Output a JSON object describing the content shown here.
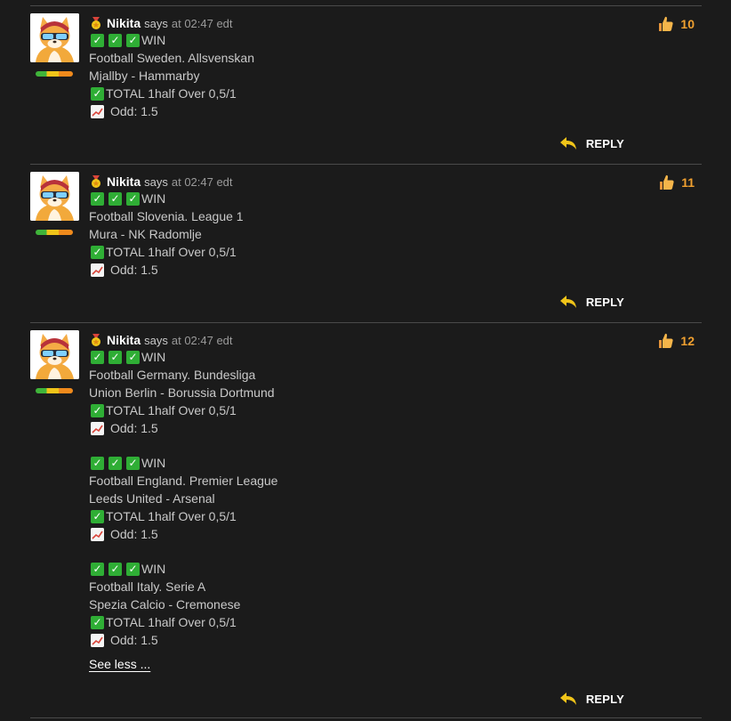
{
  "comments": [
    {
      "author": "Nikita",
      "says": "says",
      "time": "at 02:47 edt",
      "likes": "10",
      "reply_label": "REPLY",
      "blocks": [
        {
          "status": "WIN",
          "league": "Football Sweden. Allsvenskan",
          "match": "Mjallby - Hammarby",
          "bet": "TOTAL 1half Over  0,5/1",
          "odd": "Odd: 1.5"
        }
      ]
    },
    {
      "author": "Nikita",
      "says": "says",
      "time": "at 02:47 edt",
      "likes": "11",
      "reply_label": "REPLY",
      "blocks": [
        {
          "status": "WIN",
          "league": "Football Slovenia. League 1",
          "match": "Mura - NK Radomlje",
          "bet": "TOTAL 1half Over  0,5/1",
          "odd": "Odd: 1.5"
        }
      ]
    },
    {
      "author": "Nikita",
      "says": "says",
      "time": "at 02:47 edt",
      "likes": "12",
      "reply_label": "REPLY",
      "see_less": "See less ...",
      "blocks": [
        {
          "status": "WIN",
          "league": "Football Germany. Bundesliga",
          "match": "Union Berlin - Borussia Dortmund",
          "bet": "TOTAL 1half Over  0,5/1",
          "odd": "Odd: 1.5"
        },
        {
          "status": "WIN",
          "league": "Football England. Premier League",
          "match": "Leeds United - Arsenal",
          "bet": "TOTAL 1half Over  0,5/1",
          "odd": "Odd: 1.5"
        },
        {
          "status": "WIN",
          "league": "Football Italy. Serie A",
          "match": "Spezia Calcio - Cremonese",
          "bet": "TOTAL 1half Over  0,5/1",
          "odd": "Odd: 1.5"
        }
      ]
    }
  ],
  "icons": {
    "check": "check-mark-icon",
    "chart": "chart-increasing-icon",
    "like": "thumbs-up-icon",
    "reply": "reply-arrow-icon",
    "rank": "medal-icon"
  },
  "colors": {
    "background": "#1b1b1b",
    "accent_orange": "#f0a030",
    "check_green": "#2fae35",
    "reply_arrow": "#f0c419"
  }
}
